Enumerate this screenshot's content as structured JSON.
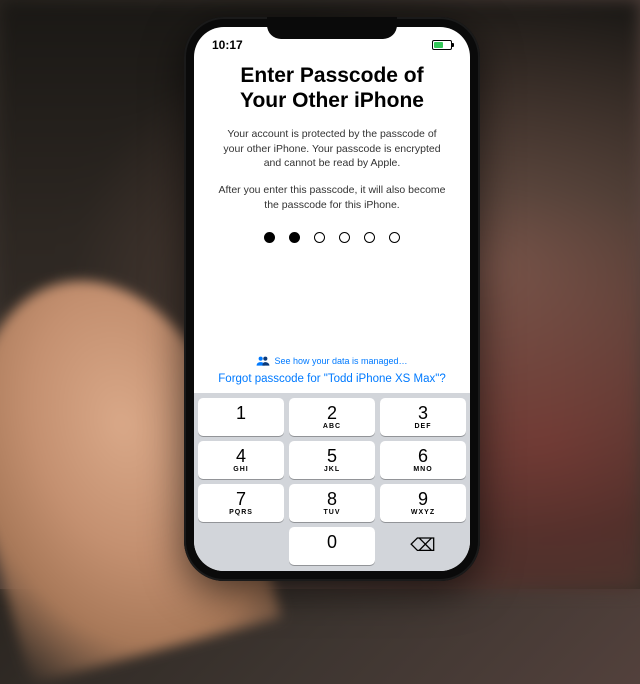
{
  "status": {
    "time": "10:17"
  },
  "title": "Enter Passcode of Your Other iPhone",
  "desc1": "Your account is protected by the passcode of your other iPhone. Your passcode is encrypted and cannot be read by Apple.",
  "desc2": "After you enter this passcode, it will also become the passcode for this iPhone.",
  "passcode": {
    "length": 6,
    "entered": 2
  },
  "manage_link": "See how your data is managed…",
  "forgot_link": "Forgot passcode for \"Todd iPhone XS Max\"?",
  "keypad": {
    "keys": [
      {
        "digit": "1",
        "letters": ""
      },
      {
        "digit": "2",
        "letters": "ABC"
      },
      {
        "digit": "3",
        "letters": "DEF"
      },
      {
        "digit": "4",
        "letters": "GHI"
      },
      {
        "digit": "5",
        "letters": "JKL"
      },
      {
        "digit": "6",
        "letters": "MNO"
      },
      {
        "digit": "7",
        "letters": "PQRS"
      },
      {
        "digit": "8",
        "letters": "TUV"
      },
      {
        "digit": "9",
        "letters": "WXYZ"
      },
      {
        "digit": "0",
        "letters": ""
      }
    ],
    "backspace_glyph": "⌫"
  },
  "colors": {
    "link": "#007aff",
    "keypad_bg": "#d2d5da",
    "battery_fill": "#34c759"
  }
}
